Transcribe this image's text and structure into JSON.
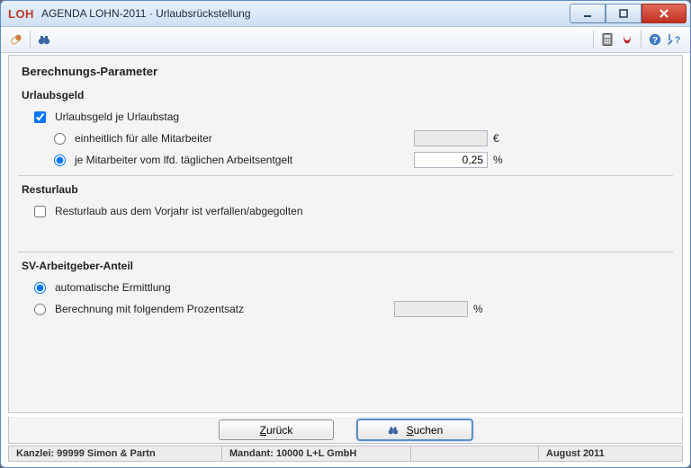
{
  "titlebar": {
    "logo": "LOH",
    "title": "AGENDA LOHN-2011 · Urlaubsrückstellung"
  },
  "content": {
    "heading": "Berechnungs-Parameter",
    "urlaubsgeld": {
      "title": "Urlaubsgeld",
      "chk_perDay_label": "Urlaubsgeld je Urlaubstag",
      "chk_perDay_checked": true,
      "opt_uniform_label": "einheitlich für alle Mitarbeiter",
      "opt_uniform_checked": false,
      "opt_perEmployee_label": "je Mitarbeiter vom lfd. täglichen Arbeitsentgelt",
      "opt_perEmployee_checked": true,
      "uniform_value": "",
      "uniform_unit": "€",
      "perEmployee_value": "0,25",
      "perEmployee_unit": "%"
    },
    "resturlaub": {
      "title": "Resturlaub",
      "chk_expired_label": "Resturlaub aus dem Vorjahr ist verfallen/abgegolten",
      "chk_expired_checked": false
    },
    "sv": {
      "title": "SV-Arbeitgeber-Anteil",
      "opt_auto_label": "automatische Ermittlung",
      "opt_auto_checked": true,
      "opt_percent_label": "Berechnung mit folgendem Prozentsatz",
      "opt_percent_checked": false,
      "percent_value": "",
      "percent_unit": "%"
    }
  },
  "buttons": {
    "back": "Zurück",
    "search": "Suchen"
  },
  "status": {
    "kanzlei": "Kanzlei: 99999 Simon & Partn",
    "mandant": "Mandant: 10000 L+L GmbH",
    "period": "August 2011"
  }
}
